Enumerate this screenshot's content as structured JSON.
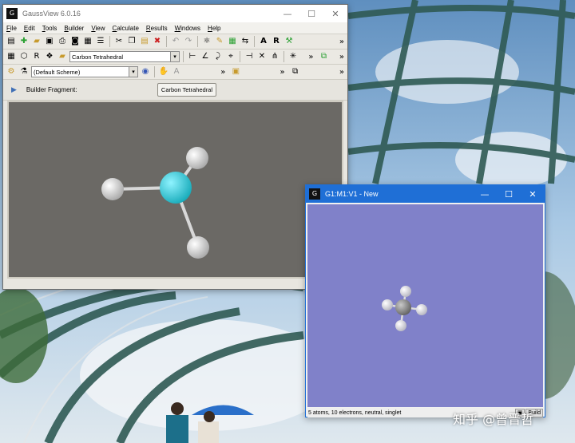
{
  "main_window": {
    "title": "GaussView 6.0.16",
    "menu": [
      "File",
      "Edit",
      "Tools",
      "Builder",
      "View",
      "Calculate",
      "Results",
      "Windows",
      "Help"
    ],
    "fragment_select_value": "Carbon Tetrahedral",
    "scheme_select_value": "(Default Scheme)",
    "builder_fragment_label": "Builder Fragment:",
    "builder_fragment_button": "Carbon Tetrahedral",
    "viewport_bg": "#6b6965"
  },
  "molecule_window": {
    "title": "G1:M1:V1 - New",
    "status_text": "5 atoms, 10 electrons, neutral, singlet",
    "status_buttons": [
      "Build"
    ],
    "viewport_bg": "#8081c9",
    "title_color": "#1f6fd6"
  },
  "watermark": {
    "text": "知乎 @曾晋哲"
  },
  "colors": {
    "carbon_fragment": "#1fc7d6",
    "hydrogen": "#f2f2f2",
    "carbon_molecule": "#7a7a7a"
  }
}
